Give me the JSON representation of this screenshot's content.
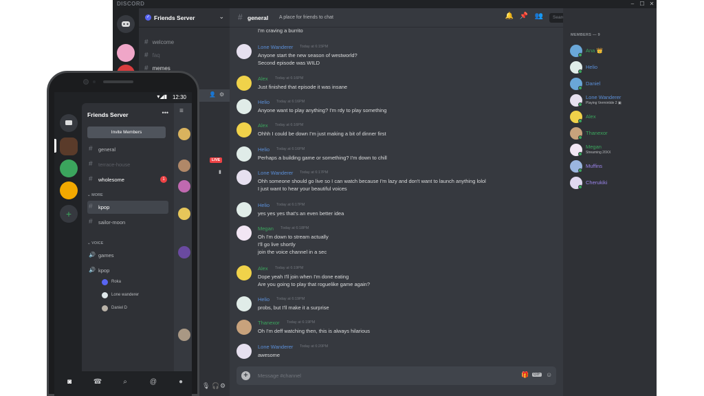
{
  "desktop": {
    "app_title": "DISCORD",
    "window_controls": [
      "–",
      "☐",
      "✕"
    ],
    "server": {
      "name": "Friends Server",
      "channels": [
        {
          "name": "welcome"
        },
        {
          "name": "faq"
        },
        {
          "name": "memes"
        }
      ]
    },
    "chat": {
      "channel": "general",
      "topic": "A place for friends to chat",
      "search_placeholder": "Search",
      "composer_placeholder": "Message #channel",
      "composer_icons": {
        "gift": "gift-icon",
        "gif": "GIF",
        "emoji": "emoji-icon"
      },
      "messages": [
        {
          "author": "",
          "time": "",
          "lines": [
            "I'm craving a burrito"
          ]
        },
        {
          "author": "Lone Wanderer",
          "color": "#5b8fd8",
          "time": "Today at 6:15PM",
          "lines": [
            "Anyone start the new season of westworld?",
            "Second episode was WILD"
          ]
        },
        {
          "author": "Alex",
          "color": "#3ba55d",
          "time": "Today at 6:16PM",
          "lines": [
            "Just finished that episode it was insane"
          ]
        },
        {
          "author": "Helio",
          "color": "#5b8fd8",
          "time": "Today at 6:16PM",
          "lines": [
            "Anyone want to play anything? I'm rdy to play something"
          ]
        },
        {
          "author": "Alex",
          "color": "#3ba55d",
          "time": "Today at 6:16PM",
          "lines": [
            "Ohhh I could be down I'm just making a bit of dinner first"
          ]
        },
        {
          "author": "Helio",
          "color": "#5b8fd8",
          "time": "Today at 6:16PM",
          "lines": [
            "Perhaps a building game or something? I'm down to chill"
          ]
        },
        {
          "author": "Lone Wanderer",
          "color": "#5b8fd8",
          "time": "Today at 6:17PM",
          "lines": [
            "Ohh someone should go live so I can watch because I'm lazy and don't want to launch anything lolol",
            "I just want to hear your beautiful voices"
          ]
        },
        {
          "author": "Helio",
          "color": "#5b8fd8",
          "time": "Today at 6:17PM",
          "lines": [
            "yes yes yes that's an even better idea"
          ]
        },
        {
          "author": "Megan",
          "color": "#3ba55d",
          "time": "Today at 6:18PM",
          "lines": [
            "Oh I'm down to stream actually",
            "I'll go live shortly",
            "join the voice channel in a sec"
          ]
        },
        {
          "author": "Alex",
          "color": "#3ba55d",
          "time": "Today at 6:19PM",
          "lines": [
            "Dope yeah I'll join when I'm done eating",
            "Are you going to play that roguelike game again?"
          ]
        },
        {
          "author": "Helio",
          "color": "#5b8fd8",
          "time": "Today at 6:19PM",
          "lines": [
            "probs, but I'll make it a surprise"
          ]
        },
        {
          "author": "Thanexor",
          "color": "#3ba55d",
          "time": "Today at 6:19PM",
          "lines": [
            "Oh I'm deff watching then, this is always hilarious"
          ]
        },
        {
          "author": "Lone Wanderer",
          "color": "#5b8fd8",
          "time": "Today at 6:20PM",
          "lines": [
            "awesome"
          ]
        }
      ]
    },
    "members": {
      "heading": "MEMBERS — 9",
      "list": [
        {
          "name": "Ana",
          "color": "#3ba55d",
          "status": "",
          "badge": "👑"
        },
        {
          "name": "Helio",
          "color": "#5b8fd8",
          "status": ""
        },
        {
          "name": "Daniel",
          "color": "#5b8fd8",
          "status": ""
        },
        {
          "name": "Lone Wanderer",
          "color": "#5b8fd8",
          "status": "Playing Vermintide 2 ▣"
        },
        {
          "name": "Alex",
          "color": "#3ba55d",
          "status": ""
        },
        {
          "name": "Thanexor",
          "color": "#3ba55d",
          "status": ""
        },
        {
          "name": "Megan",
          "color": "#3ba55d",
          "status": "Streaming 20XX"
        },
        {
          "name": "Muffins",
          "color": "#9b84ec",
          "status": ""
        },
        {
          "name": "Cherukiki",
          "color": "#9b84ec",
          "status": ""
        }
      ]
    }
  },
  "phone": {
    "time": "12:30",
    "server_name": "Friends Server",
    "more_dots": "•••",
    "invite_label": "Invite Members",
    "channels": [
      {
        "name": "general"
      },
      {
        "name": "terrace-house"
      },
      {
        "name": "wholesome",
        "badge": "1"
      }
    ],
    "category_more": "MORE",
    "more_channels": [
      {
        "name": "kpop"
      },
      {
        "name": "sailor-moon"
      }
    ],
    "category_voice": "VOICE",
    "voice_channels": [
      {
        "name": "games"
      },
      {
        "name": "kpop"
      }
    ],
    "voice_users": [
      "Roka",
      "Lone wanderer",
      "Daniel D"
    ],
    "live_label": "LIVE"
  },
  "colors": {
    "blurple": "#5865f2",
    "green": "#3ba55d",
    "red": "#ed4245"
  }
}
